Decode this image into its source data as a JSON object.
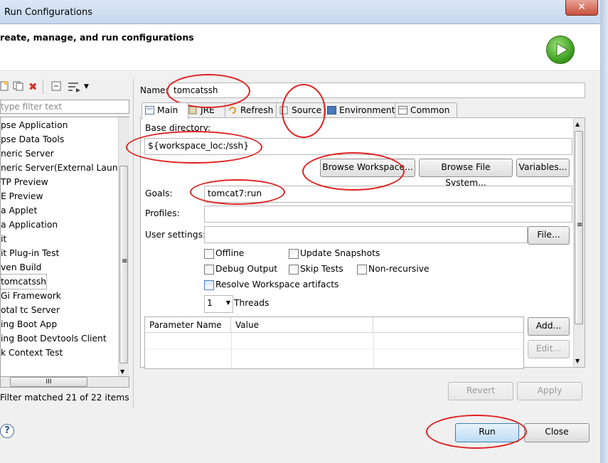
{
  "window": {
    "title": "Run Configurations",
    "close_glyph": "✕"
  },
  "header": {
    "title": "reate, manage, and run configurations"
  },
  "toolbar_icons": [
    "new-config-icon",
    "duplicate-icon",
    "delete-icon",
    "collapse-all-icon",
    "filter-icon",
    "dropdown-icon"
  ],
  "sidebar": {
    "filter_placeholder": "type filter text",
    "items": [
      "pse Application",
      "pse Data Tools",
      "neric Server",
      "neric Server(External Launch)",
      "TP Preview",
      "E Preview",
      "a Applet",
      "a Application",
      "it",
      "it Plug-in Test",
      "ven Build",
      "tomcatssh",
      "Gi Framework",
      "otal tc Server",
      "ing Boot App",
      "ing Boot Devtools Client",
      "k Context Test"
    ],
    "filter_message": "Filter matched 21 of 22 items",
    "hscroll_glyph": "III",
    "menu_glyph": "≡"
  },
  "config": {
    "name_label": "Name:",
    "name_value": "tomcatssh"
  },
  "tabs": [
    "Main",
    "JRE",
    "Refresh",
    "Source",
    "Environment",
    "Common"
  ],
  "main": {
    "base_dir_label": "Base directory:",
    "base_dir_value": "${workspace_loc:/ssh}",
    "browse_workspace": "Browse Workspace...",
    "browse_fs": "Browse File System...",
    "variables": "Variables...",
    "goals_label": "Goals:",
    "goals_value": "tomcat7:run",
    "profiles_label": "Profiles:",
    "profiles_value": "",
    "user_settings_label": "User settings:",
    "user_settings_value": "",
    "file_button": "File...",
    "checkboxes": {
      "offline": "Offline",
      "update_snapshots": "Update Snapshots",
      "debug_output": "Debug Output",
      "skip_tests": "Skip Tests",
      "non_recursive": "Non-recursive",
      "resolve_workspace": "Resolve Workspace artifacts"
    },
    "threads_value": "1",
    "threads_label": "Threads",
    "param_headers": [
      "Parameter Name",
      "Value"
    ],
    "add_button": "Add...",
    "edit_button": "Edit..."
  },
  "actions": {
    "revert": "Revert",
    "apply": "Apply",
    "run": "Run",
    "close": "Close",
    "help_glyph": "?"
  },
  "colors": {
    "annotation_red": "#e02020",
    "run_green": "#3c9c1e",
    "delete_red": "#d0342c"
  }
}
